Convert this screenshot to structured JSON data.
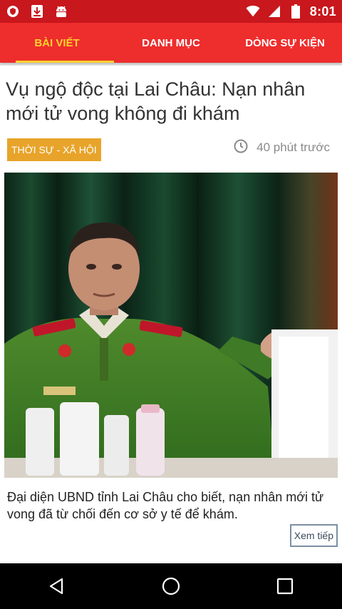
{
  "status_bar": {
    "time": "8:01",
    "icons": [
      "shield-notification-icon",
      "download-icon",
      "android-icon",
      "wifi-icon",
      "cellular-signal-icon",
      "battery-icon"
    ]
  },
  "tabs": [
    {
      "label": "BÀI VIẾT",
      "active": true
    },
    {
      "label": "DANH MỤC",
      "active": false
    },
    {
      "label": "DÒNG SỰ KIỆN",
      "active": false
    }
  ],
  "article": {
    "title": "Vụ ngộ độc tại Lai Châu: Nạn nhân mới tử vong không đi khám",
    "category": "THỜI SỰ - XÃ HỘI",
    "time_ago": "40 phút trước",
    "summary": "Đại diện UBND tỉnh Lai Châu cho biết, nạn nhân mới tử vong đã từ chối đến cơ sở y tế để khám.",
    "more_label": "Xem tiếp"
  },
  "colors": {
    "status_bar": "#c8171d",
    "tab_bar": "#ee2d2d",
    "tab_active": "#ffd22e",
    "category_badge": "#e8a42a"
  },
  "nav": [
    "back-icon",
    "home-icon",
    "recents-icon"
  ]
}
